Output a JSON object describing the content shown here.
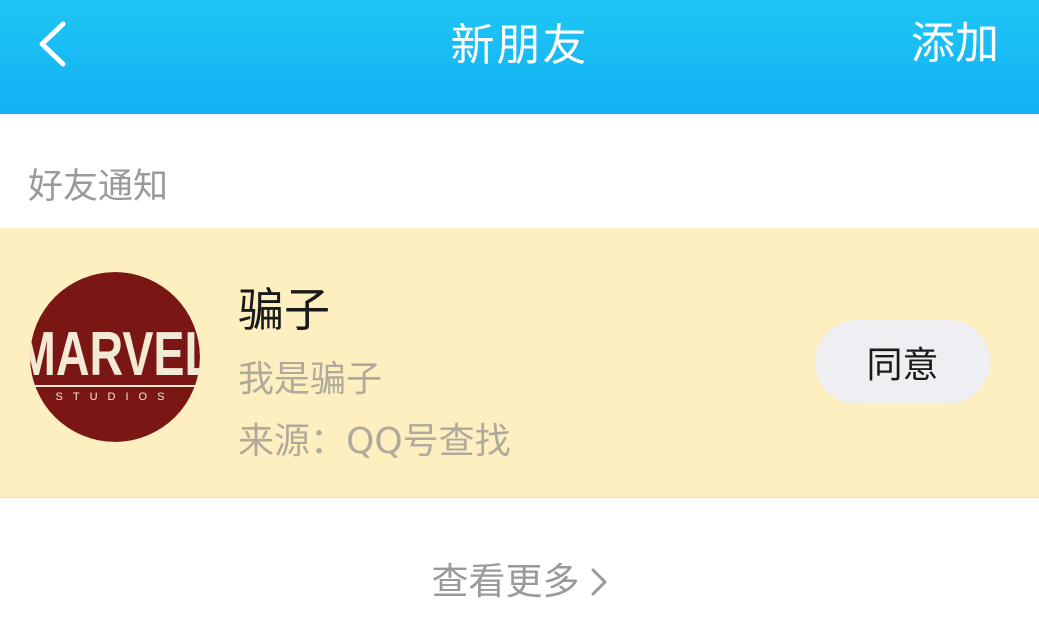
{
  "header": {
    "title": "新朋友",
    "add_label": "添加"
  },
  "section": {
    "label": "好友通知"
  },
  "notification": {
    "name": "骗子",
    "message": "我是骗子",
    "source": "来源：QQ号查找",
    "agree_label": "同意",
    "avatar": {
      "brand": "MARVEL",
      "sub": "STUDIOS",
      "bg_color": "#7a1714",
      "text_color": "#f3ead6"
    }
  },
  "footer": {
    "see_more_label": "查看更多"
  },
  "colors": {
    "header_bg": "#12b0f5",
    "row_bg": "#fdefc0",
    "button_bg": "#eeeef3",
    "muted_text": "#9a9a9a"
  }
}
